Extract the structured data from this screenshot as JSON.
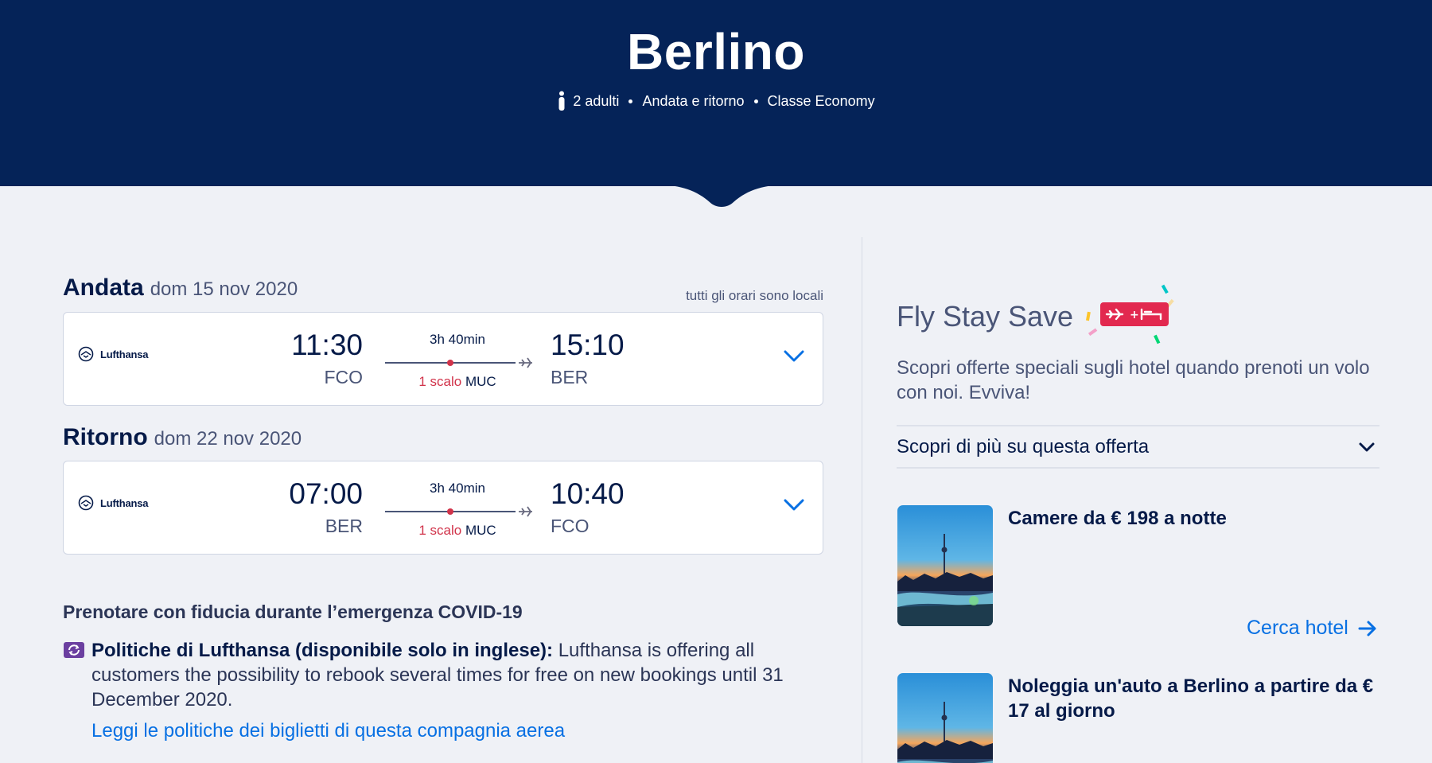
{
  "header": {
    "title": "Berlino",
    "passengers": "2 adulti",
    "trip_type": "Andata e ritorno",
    "cabin_class": "Classe Economy"
  },
  "outbound": {
    "heading": "Andata",
    "date": "dom 15 nov 2020",
    "note": "tutti gli orari sono locali",
    "airline": "Lufthansa",
    "dep_time": "11:30",
    "dep_code": "FCO",
    "arr_time": "15:10",
    "arr_code": "BER",
    "duration": "3h 40min",
    "stops": "1 scalo",
    "stop_airport": "MUC"
  },
  "inbound": {
    "heading": "Ritorno",
    "date": "dom 22 nov 2020",
    "airline": "Lufthansa",
    "dep_time": "07:00",
    "dep_code": "BER",
    "arr_time": "10:40",
    "arr_code": "FCO",
    "duration": "3h 40min",
    "stops": "1 scalo",
    "stop_airport": "MUC"
  },
  "covid": {
    "title": "Prenotare con fiducia durante l’emergenza COVID-19",
    "policy_label": "Politiche di Lufthansa (disponibile solo in inglese):",
    "policy_text": " Lufthansa is offering all customers the possibility to rebook several times for free on new bookings until 31 December 2020.",
    "link": "Leggi le politiche dei biglietti di questa compagnia aerea"
  },
  "fly_stay_save": {
    "title": "Fly Stay Save",
    "badge_plus": "+",
    "description": "Scopri offerte speciali sugli hotel quando prenoti un volo con noi. Evviva!",
    "more_label": "Scopri di più su questa offerta",
    "offers": [
      {
        "title": "Camere da € 198 a notte",
        "link": "Cerca hotel"
      },
      {
        "title": "Noleggia un'auto a Berlino a partire da € 17 al giorno"
      }
    ]
  },
  "colors": {
    "header_bg": "#052358",
    "link": "#0770e3",
    "stop_red": "#d1334a",
    "page_bg": "#eff1f6"
  }
}
